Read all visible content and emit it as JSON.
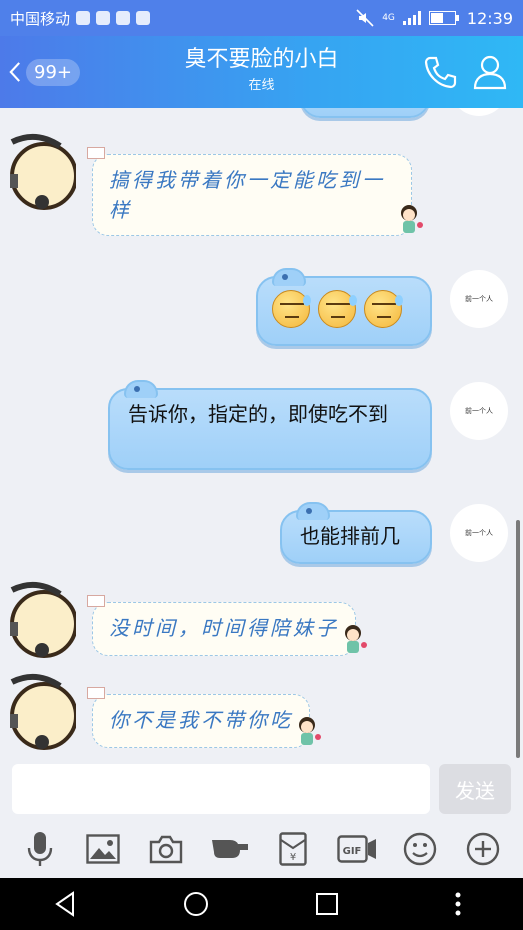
{
  "status_bar": {
    "carrier": "中国移动",
    "network": "4G",
    "time": "12:39"
  },
  "header": {
    "unread_count": "99+",
    "title": "臭不要脸的小白",
    "status": "在线"
  },
  "messages": [
    {
      "side": "left",
      "style": "handwriting",
      "text": "搞得我带着你一定能吃到一样"
    },
    {
      "side": "right",
      "style": "emoji",
      "emoji_count": 3,
      "emoji": "sweat-face"
    },
    {
      "side": "right",
      "style": "bubble",
      "text": "告诉你，指定的，即使吃不到"
    },
    {
      "side": "right",
      "style": "bubble",
      "text": "也能排前几"
    },
    {
      "side": "left",
      "style": "handwriting",
      "text": "没时间，时间得陪妹子"
    },
    {
      "side": "left",
      "style": "handwriting",
      "text": "你不是我不带你吃"
    }
  ],
  "my_avatar_text": "前一个人",
  "input": {
    "value": "",
    "send_label": "发送"
  },
  "toolbar": [
    "mic-icon",
    "image-icon",
    "camera-icon",
    "poke-icon",
    "red-packet-icon",
    "gif-icon",
    "emoji-icon",
    "plus-icon"
  ],
  "colors": {
    "header_start": "#4d7ae9",
    "header_end": "#2fb8f5",
    "bubble": "#a8d4f9",
    "handwriting": "#3a78c2"
  }
}
